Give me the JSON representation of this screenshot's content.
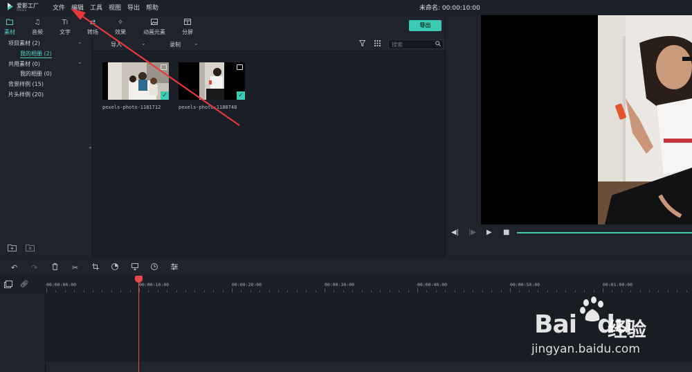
{
  "app": {
    "logo_text": "爱影工厂",
    "logo_sub": "filmora",
    "menu": [
      "文件",
      "编辑",
      "工具",
      "视图",
      "导出",
      "帮助"
    ],
    "project_title": "未命名: 00:00:10:00"
  },
  "tabs": [
    {
      "label": "素材",
      "icon": "folder-icon"
    },
    {
      "label": "音频",
      "icon": "music-icon"
    },
    {
      "label": "文字",
      "icon": "text-icon"
    },
    {
      "label": "转场",
      "icon": "transition-icon"
    },
    {
      "label": "效果",
      "icon": "effects-icon"
    },
    {
      "label": "动画元素",
      "icon": "elements-icon"
    },
    {
      "label": "分屏",
      "icon": "split-screen-icon"
    }
  ],
  "export_label": "导出",
  "sidebar": {
    "items": [
      {
        "label": "项目素材 (2)"
      },
      {
        "label": "我的相册 (2)"
      },
      {
        "label": "共用素材 (0)"
      },
      {
        "label": "我的相册 (0)"
      },
      {
        "label": "背景样例 (15)"
      },
      {
        "label": "片头样例 (20)"
      }
    ]
  },
  "media_toolbar": {
    "import_label": "导入",
    "record_label": "录制",
    "search_placeholder": "搜索"
  },
  "media_items": [
    {
      "name": "pexels-photo-1181712",
      "selected": true
    },
    {
      "name": "pexels-photo-1188748",
      "selected": true
    }
  ],
  "timeline": {
    "ruler_labels": [
      "00:00:00:00",
      "00:00:10:00",
      "00:00:20:00",
      "00:00:30:00",
      "00:00:40:00",
      "00:00:50:00",
      "00:01:00:00"
    ]
  },
  "watermark": {
    "brand": "Bai",
    "brand_tail": "du",
    "cn": "经验",
    "url": "jingyan.baidu.com"
  },
  "colors": {
    "accent": "#3ccab3",
    "playhead": "#e8484a",
    "annotation_arrow": "#e8383b"
  }
}
